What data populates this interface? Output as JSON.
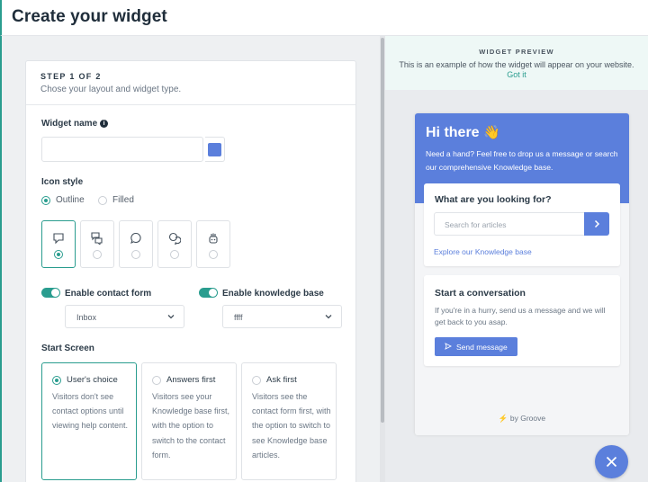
{
  "page": {
    "title": "Create your widget"
  },
  "step": {
    "heading": "STEP 1 OF 2",
    "subtitle": "Chose your layout and widget type."
  },
  "widget_name": {
    "label": "Widget name",
    "value": "",
    "placeholder": "",
    "accent_color": "#5b7fdc"
  },
  "icon_style": {
    "label": "Icon style",
    "options": [
      "Outline",
      "Filled"
    ],
    "selected": "Outline",
    "icons": [
      "chat-bubble-icon",
      "chat-bubbles-icon",
      "speech-round-icon",
      "chat-round-double-icon",
      "robot-hand-icon"
    ],
    "selected_icon": 0
  },
  "toggles": {
    "contact_form": {
      "label": "Enable contact form",
      "on": true,
      "select_value": "Inbox"
    },
    "knowledge_base": {
      "label": "Enable knowledge base",
      "on": true,
      "select_value": "ffff"
    }
  },
  "start_screen": {
    "label": "Start Screen",
    "options": [
      {
        "title": "User's choice",
        "desc": "Visitors don't see contact options until viewing help content.",
        "selected": true
      },
      {
        "title": "Answers first",
        "desc": "Visitors see your Knowledge base first, with the option to switch to the contact form.",
        "selected": false
      },
      {
        "title": "Ask first",
        "desc": "Visitors see the contact form first, with the option to switch to see Knowledge base articles.",
        "selected": false
      }
    ]
  },
  "preview": {
    "heading": "WIDGET PREVIEW",
    "desc": "This is an example of how the widget will appear on your website.",
    "got_it": "Got it"
  },
  "widget": {
    "greeting": "Hi there",
    "greeting_emoji": "👋",
    "intro": "Need a hand? Feel free to drop us a message or search our comprehensive Knowledge base.",
    "search_title": "What are you looking for?",
    "search_placeholder": "Search for articles",
    "kb_link": "Explore our Knowledge base",
    "conv_title": "Start a conversation",
    "conv_desc": "If you're in a hurry, send us a message and we will get back to you asap.",
    "send_label": "Send message",
    "branding": "by Groove",
    "colors": {
      "primary": "#5b7fdc",
      "accent": "#2a9d8f"
    }
  }
}
